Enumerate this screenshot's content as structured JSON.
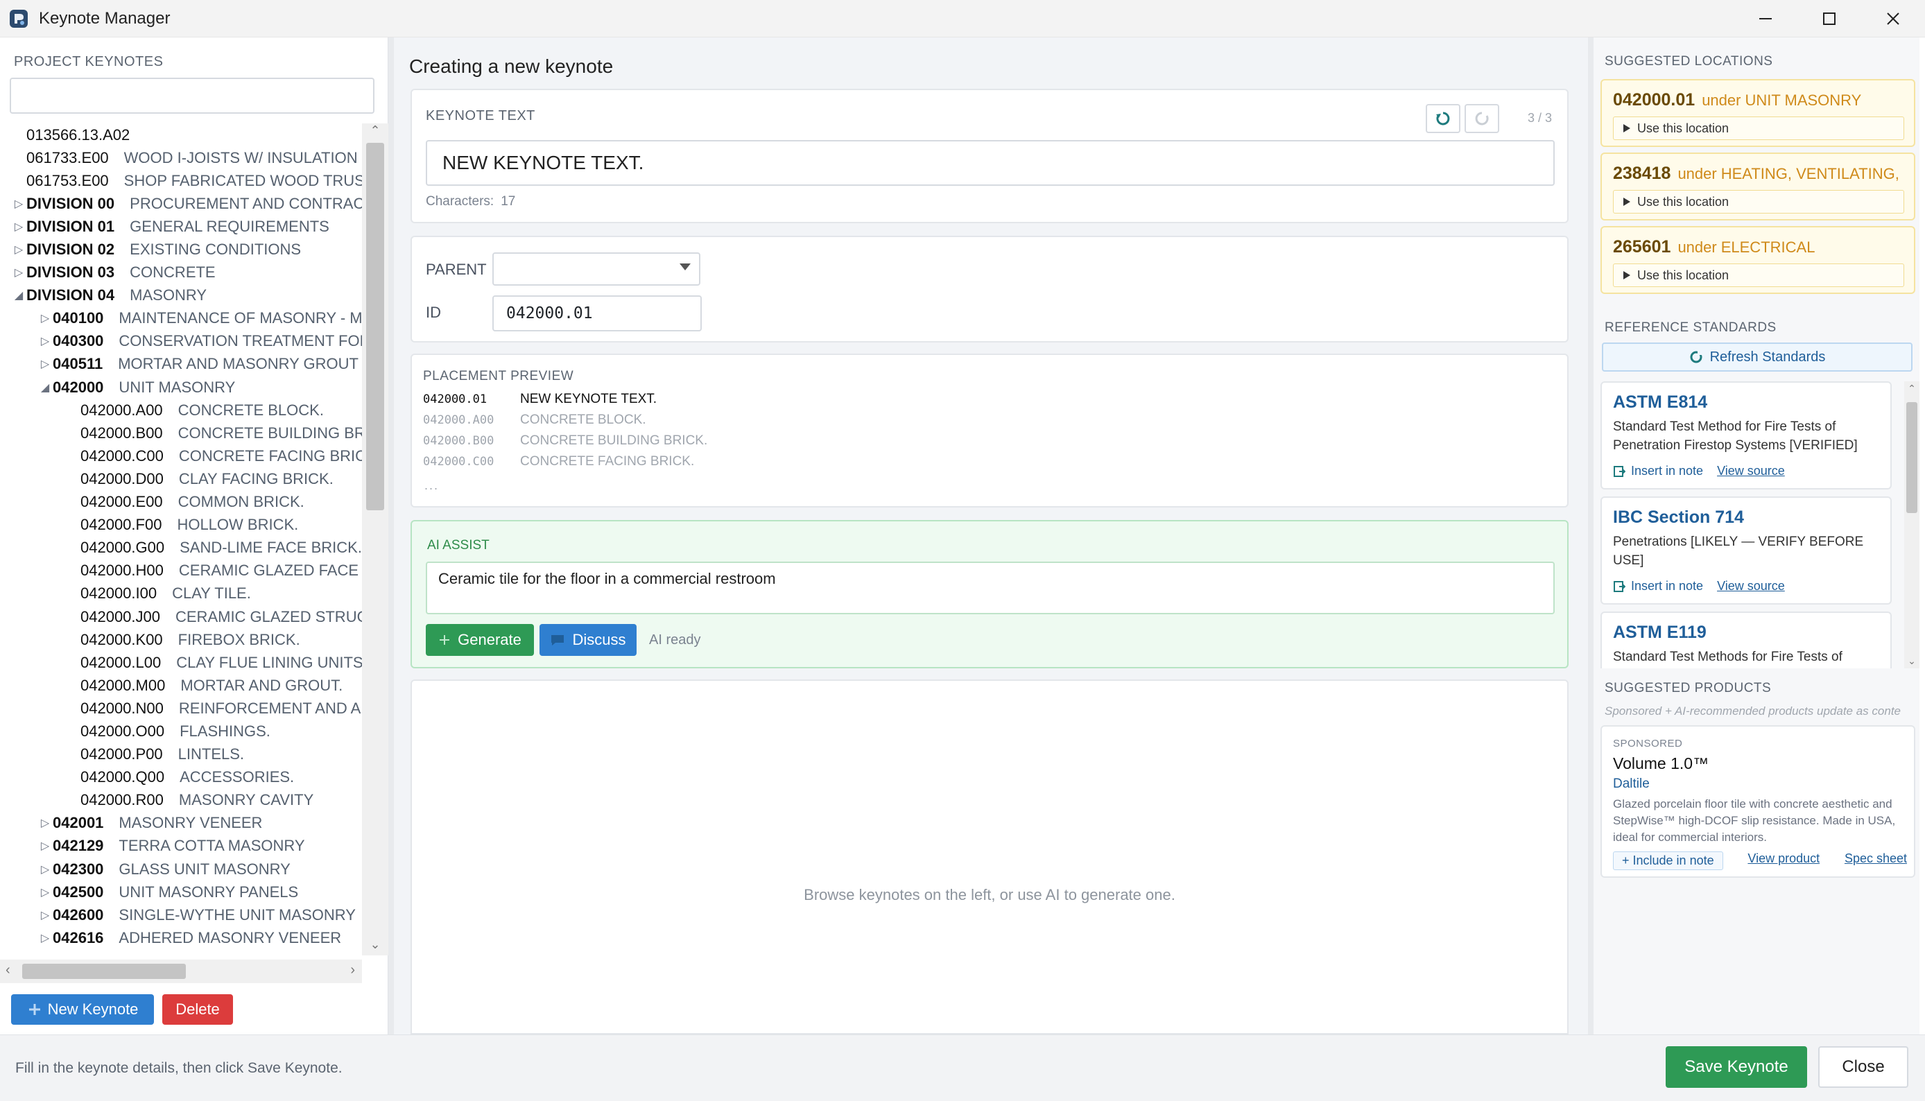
{
  "window": {
    "title": "Keynote Manager"
  },
  "left": {
    "heading": "PROJECT KEYNOTES",
    "search_value": "",
    "tree": [
      {
        "arrow": "",
        "indent": 0,
        "code": "013566.13.A02",
        "desc": "",
        "bold": false
      },
      {
        "arrow": "",
        "indent": 0,
        "code": "061733.E00",
        "desc": "WOOD I-JOISTS W/ INSULATION",
        "bold": false
      },
      {
        "arrow": "",
        "indent": 0,
        "code": "061753.E00",
        "desc": "SHOP FABRICATED WOOD TRUSSES",
        "bold": false
      },
      {
        "arrow": "▷",
        "indent": 0,
        "code": "DIVISION 00",
        "desc": "PROCUREMENT AND CONTRACTING",
        "bold": true
      },
      {
        "arrow": "▷",
        "indent": 0,
        "code": "DIVISION 01",
        "desc": "GENERAL REQUIREMENTS",
        "bold": true
      },
      {
        "arrow": "▷",
        "indent": 0,
        "code": "DIVISION 02",
        "desc": "EXISTING CONDITIONS",
        "bold": true
      },
      {
        "arrow": "▷",
        "indent": 0,
        "code": "DIVISION 03",
        "desc": "CONCRETE",
        "bold": true
      },
      {
        "arrow": "◢",
        "indent": 0,
        "code": "DIVISION 04",
        "desc": "MASONRY",
        "bold": true
      },
      {
        "arrow": "▷",
        "indent": 1,
        "code": "040100",
        "desc": "MAINTENANCE OF MASONRY - MT",
        "bold": true
      },
      {
        "arrow": "▷",
        "indent": 1,
        "code": "040300",
        "desc": "CONSERVATION TREATMENT FOR P",
        "bold": true
      },
      {
        "arrow": "▷",
        "indent": 1,
        "code": "040511",
        "desc": "MORTAR AND MASONRY GROUT",
        "bold": true
      },
      {
        "arrow": "◢",
        "indent": 1,
        "code": "042000",
        "desc": "UNIT MASONRY",
        "bold": true
      },
      {
        "arrow": "",
        "indent": 2,
        "code": "042000.A00",
        "desc": "CONCRETE BLOCK.",
        "bold": false
      },
      {
        "arrow": "",
        "indent": 2,
        "code": "042000.B00",
        "desc": "CONCRETE BUILDING BRICK",
        "bold": false
      },
      {
        "arrow": "",
        "indent": 2,
        "code": "042000.C00",
        "desc": "CONCRETE FACING BRICK.",
        "bold": false
      },
      {
        "arrow": "",
        "indent": 2,
        "code": "042000.D00",
        "desc": "CLAY FACING BRICK.",
        "bold": false
      },
      {
        "arrow": "",
        "indent": 2,
        "code": "042000.E00",
        "desc": "COMMON BRICK.",
        "bold": false
      },
      {
        "arrow": "",
        "indent": 2,
        "code": "042000.F00",
        "desc": "HOLLOW BRICK.",
        "bold": false
      },
      {
        "arrow": "",
        "indent": 2,
        "code": "042000.G00",
        "desc": "SAND-LIME FACE BRICK.",
        "bold": false
      },
      {
        "arrow": "",
        "indent": 2,
        "code": "042000.H00",
        "desc": "CERAMIC GLAZED FACE BR",
        "bold": false
      },
      {
        "arrow": "",
        "indent": 2,
        "code": "042000.I00",
        "desc": "CLAY TILE.",
        "bold": false
      },
      {
        "arrow": "",
        "indent": 2,
        "code": "042000.J00",
        "desc": "CERAMIC GLAZED STRUCTU",
        "bold": false
      },
      {
        "arrow": "",
        "indent": 2,
        "code": "042000.K00",
        "desc": "FIREBOX BRICK.",
        "bold": false
      },
      {
        "arrow": "",
        "indent": 2,
        "code": "042000.L00",
        "desc": "CLAY FLUE LINING UNITS.",
        "bold": false
      },
      {
        "arrow": "",
        "indent": 2,
        "code": "042000.M00",
        "desc": "MORTAR AND GROUT.",
        "bold": false
      },
      {
        "arrow": "",
        "indent": 2,
        "code": "042000.N00",
        "desc": "REINFORCEMENT AND AN",
        "bold": false
      },
      {
        "arrow": "",
        "indent": 2,
        "code": "042000.O00",
        "desc": "FLASHINGS.",
        "bold": false
      },
      {
        "arrow": "",
        "indent": 2,
        "code": "042000.P00",
        "desc": "LINTELS.",
        "bold": false
      },
      {
        "arrow": "",
        "indent": 2,
        "code": "042000.Q00",
        "desc": "ACCESSORIES.",
        "bold": false
      },
      {
        "arrow": "",
        "indent": 2,
        "code": "042000.R00",
        "desc": "MASONRY CAVITY",
        "bold": false
      },
      {
        "arrow": "▷",
        "indent": 1,
        "code": "042001",
        "desc": "MASONRY VENEER",
        "bold": true
      },
      {
        "arrow": "▷",
        "indent": 1,
        "code": "042129",
        "desc": "TERRA COTTA MASONRY",
        "bold": true
      },
      {
        "arrow": "▷",
        "indent": 1,
        "code": "042300",
        "desc": "GLASS UNIT MASONRY",
        "bold": true
      },
      {
        "arrow": "▷",
        "indent": 1,
        "code": "042500",
        "desc": "UNIT MASONRY PANELS",
        "bold": true
      },
      {
        "arrow": "▷",
        "indent": 1,
        "code": "042600",
        "desc": "SINGLE-WYTHE UNIT MASONRY",
        "bold": true
      },
      {
        "arrow": "▷",
        "indent": 1,
        "code": "042616",
        "desc": "ADHERED MASONRY VENEER",
        "bold": true
      }
    ],
    "new_button": "New Keynote",
    "delete_button": "Delete"
  },
  "center": {
    "heading": "Creating a new keynote",
    "keynote_text_label": "KEYNOTE TEXT",
    "keynote_text_value": "NEW KEYNOTE TEXT.",
    "characters_label": "Characters:",
    "characters_count": "17",
    "history_step": "3 / 3",
    "parent_label": "PARENT",
    "parent_value": "",
    "id_label": "ID",
    "id_value": "042000.01",
    "preview_label": "PLACEMENT PREVIEW",
    "preview": [
      {
        "id": "042000.01",
        "text": "NEW KEYNOTE TEXT.",
        "active": true
      },
      {
        "id": "042000.A00",
        "text": "CONCRETE BLOCK.",
        "active": false
      },
      {
        "id": "042000.B00",
        "text": "CONCRETE BUILDING BRICK.",
        "active": false
      },
      {
        "id": "042000.C00",
        "text": "CONCRETE FACING BRICK.",
        "active": false
      }
    ],
    "preview_more": "...",
    "ai_label": "AI ASSIST",
    "ai_prompt": "Ceramic tile for the floor in a commercial restroom",
    "generate_button": "Generate",
    "discuss_button": "Discuss",
    "ai_status": "AI ready",
    "empty_message": "Browse keynotes on the left, or use AI to generate one."
  },
  "right": {
    "locations_heading": "SUGGESTED LOCATIONS",
    "under_word": "under",
    "use_location_label": "Use this location",
    "locations": [
      {
        "code": "042000.01",
        "name": "UNIT MASONRY"
      },
      {
        "code": "238418",
        "name": "HEATING, VENTILATING,"
      },
      {
        "code": "265601",
        "name": "ELECTRICAL"
      }
    ],
    "standards_heading": "REFERENCE STANDARDS",
    "refresh_button": "Refresh Standards",
    "insert_label": "Insert in note",
    "source_label": "View source",
    "standards": [
      {
        "title": "ASTM E814",
        "desc": "Standard Test Method for Fire Tests of Penetration Firestop Systems [VERIFIED]"
      },
      {
        "title": "IBC Section 714",
        "desc": "Penetrations [LIKELY — VERIFY BEFORE USE]"
      },
      {
        "title": "ASTM E119",
        "desc": "Standard Test Methods for Fire Tests of Building Construction and Materials"
      }
    ],
    "products_heading": "SUGGESTED PRODUCTS",
    "products_note": "Sponsored + AI-recommended products update as conte",
    "product": {
      "badge": "SPONSORED",
      "name": "Volume 1.0™",
      "brand": "Daltile",
      "desc": "Glazed porcelain floor tile with concrete aesthetic and StepWise™ high-DCOF slip resistance. Made in USA, ideal for commercial interiors.",
      "include": "+ Include in note",
      "view": "View product",
      "spec": "Spec sheet"
    }
  },
  "footer": {
    "status": "Fill in the keynote details, then click Save Keynote.",
    "save_button": "Save Keynote",
    "close_button": "Close"
  },
  "colors": {
    "primary_blue": "#2f7fd0",
    "success_green": "#2e9a55",
    "danger_red": "#dc3c3c",
    "location_amber": "#cf8a1a"
  }
}
